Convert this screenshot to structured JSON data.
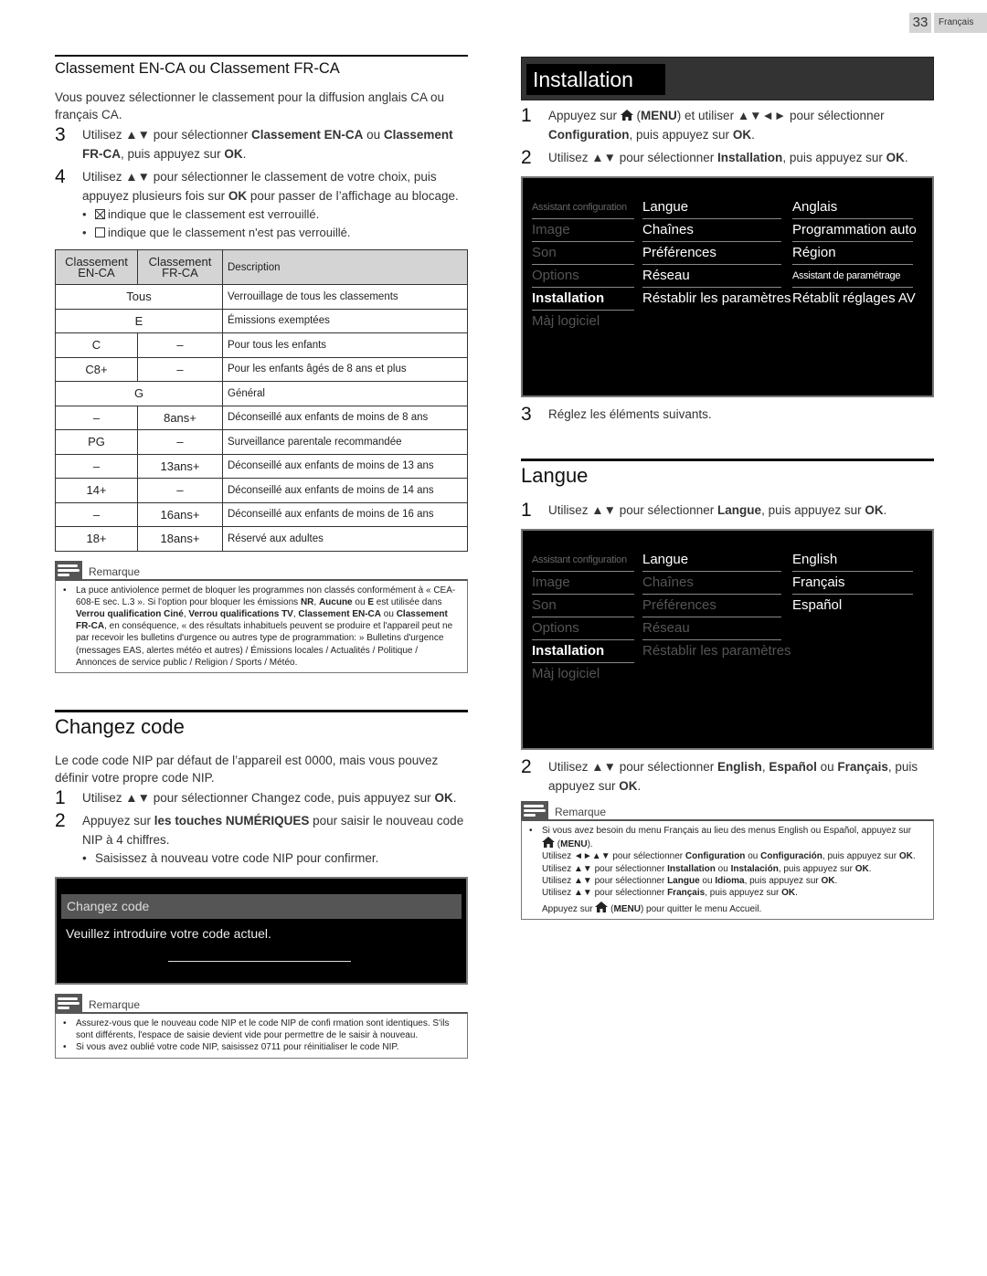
{
  "header": {
    "page_number": "33",
    "language": "Français"
  },
  "classement": {
    "title": "Classement EN-CA ou Classement FR-CA",
    "intro": "Vous pouvez sélectionner le classement pour la diffusion anglais CA ou français CA.",
    "step3": {
      "num": "3",
      "t1": "Utilisez ▲▼ pour sélectionner ",
      "b1": "Classement EN-CA",
      "t2": " ou ",
      "b2": "Classement FR-CA",
      "t3": ", puis appuyez sur ",
      "b3": "OK",
      "t4": "."
    },
    "step4": {
      "num": "4",
      "t1": "Utilisez ▲▼ pour sélectionner le classement de votre choix, puis appuyez plusieurs fois sur ",
      "b1": "OK",
      "t2": " pour passer de l’affichage au blocage."
    },
    "bullets": [
      {
        "icon": "checked-box",
        "text": "indique que le classement est verrouillé."
      },
      {
        "icon": "empty-box",
        "text": "indique que le classement n'est pas verrouillé."
      }
    ],
    "table": {
      "headers": [
        "Classement EN-CA",
        "Classement FR-CA",
        "Description"
      ],
      "rows": [
        {
          "en": "Tous",
          "fr": "",
          "merged": true,
          "desc": "Verrouillage de tous les classements"
        },
        {
          "en": "E",
          "fr": "",
          "merged": true,
          "desc": "Émissions exemptées"
        },
        {
          "en": "C",
          "fr": "–",
          "merged": false,
          "desc": "Pour tous les enfants"
        },
        {
          "en": "C8+",
          "fr": "–",
          "merged": false,
          "desc": "Pour les enfants âgés de 8 ans et plus"
        },
        {
          "en": "G",
          "fr": "",
          "merged": true,
          "desc": "Général"
        },
        {
          "en": "–",
          "fr": "8ans+",
          "merged": false,
          "desc": "Déconseillé aux enfants de moins de 8 ans"
        },
        {
          "en": "PG",
          "fr": "–",
          "merged": false,
          "desc": "Surveillance parentale recommandée"
        },
        {
          "en": "–",
          "fr": "13ans+",
          "merged": false,
          "desc": "Déconseillé aux enfants de moins de 13 ans"
        },
        {
          "en": "14+",
          "fr": "–",
          "merged": false,
          "desc": "Déconseillé aux enfants de moins de 14 ans"
        },
        {
          "en": "–",
          "fr": "16ans+",
          "merged": false,
          "desc": "Déconseillé aux enfants de moins de 16 ans"
        },
        {
          "en": "18+",
          "fr": "18ans+",
          "merged": false,
          "desc": "Réservé aux adultes"
        }
      ]
    },
    "note": {
      "title": "Remarque",
      "html_parts": {
        "a": "La puce antiviolence permet de bloquer les programmes non classés conformément à « CEA-608-E sec. L.3 ». Si l'option pour bloquer les émissions ",
        "b1": "NR",
        "c1": ", ",
        "b2": "Aucune",
        "c2": " ou ",
        "b3": "E",
        "c3": " est utilisée dans ",
        "b4": "Verrou qualification Ciné",
        "c4": ", ",
        "b5": "Verrou qualifications TV",
        "c5": ", ",
        "b6": "Classement EN-CA",
        "c6": " ou ",
        "b7": "Classement FR-CA",
        "c7": ", en conséquence, « des résultats inhabituels peuvent se produire et l'appareil peut ne par recevoir les bulletins d'urgence ou autres type de programmation: » Bulletins d'urgence (messages EAS, alertes météo et autres) / Émissions locales / Actualités / Politique / Annonces de service public / Religion / Sports / Météo."
      }
    }
  },
  "changez": {
    "title": "Changez code",
    "intro": "Le code code NIP par défaut de l’appareil est 0000, mais vous pouvez définir votre propre code NIP.",
    "step1": {
      "num": "1",
      "t1": "Utilisez ▲▼ pour sélectionner Changez code, puis appuyez sur ",
      "b1": "OK",
      "t2": "."
    },
    "step2": {
      "num": "2",
      "t1": "Appuyez sur ",
      "b1": "les touches NUMÉRIQUES",
      "t2": " pour saisir le nouveau code NIP à 4 chiffres."
    },
    "bullet": "Saisissez à nouveau votre code NIP pour confirmer.",
    "screen": {
      "title": "Changez code",
      "message": "Veuillez introduire votre code actuel.",
      "pin_value": ""
    },
    "note": {
      "title": "Remarque",
      "items": [
        "Assurez-vous que le nouveau code NIP et le code NIP de confi rmation sont identiques. S'ils sont différents, l'espace de saisie devient vide pour permettre de le saisir à nouveau.",
        "Si vous avez oublié votre code NIP, saisissez 0711 pour réinitialiser le code NIP."
      ]
    }
  },
  "installation": {
    "title": "Installation",
    "step1": {
      "num": "1",
      "t1": "Appuyez sur ",
      "t1b": " (",
      "b1": "MENU",
      "t2": ") et utiliser ▲▼◄► pour sélectionner ",
      "b2": "Configuration",
      "t3": ", puis appuyez sur ",
      "b3": "OK",
      "t4": "."
    },
    "step2": {
      "num": "2",
      "t1": "Utilisez ▲▼ pour sélectionner ",
      "b1": "Installation",
      "t2": ", puis appuyez sur ",
      "b2": "OK",
      "t3": "."
    },
    "menu": {
      "col1": [
        "Assistant configuration",
        "Image",
        "Son",
        "Options",
        "Installation",
        "Màj logiciel"
      ],
      "col2": [
        "Langue",
        "Chaînes",
        "Préférences",
        "Réseau",
        "Réstablir les paramètres"
      ],
      "col3": [
        "Anglais",
        "Programmation auto",
        "Région",
        "Assistant de paramétrage",
        "Rétablit réglages AV"
      ]
    },
    "step3": {
      "num": "3",
      "text": "Réglez les éléments suivants."
    }
  },
  "langue": {
    "title": "Langue",
    "step1": {
      "num": "1",
      "t1": "Utilisez ▲▼ pour sélectionner ",
      "b1": "Langue",
      "t2": ", puis appuyez sur ",
      "b2": "OK",
      "t3": "."
    },
    "menu": {
      "col1": [
        "Assistant configuration",
        "Image",
        "Son",
        "Options",
        "Installation",
        "Màj logiciel"
      ],
      "col2": [
        "Langue",
        "Chaînes",
        "Préférences",
        "Réseau",
        "Réstablir les paramètres"
      ],
      "col3": [
        "English",
        "Français",
        "Español"
      ]
    },
    "step2": {
      "num": "2",
      "t1": "Utilisez ▲▼ pour sélectionner ",
      "b1": "English",
      "t2": ", ",
      "b2": "Español",
      "t3": " ou ",
      "b3": "Français",
      "t4": ", puis appuyez sur ",
      "b4": "OK",
      "t5": "."
    },
    "note": {
      "title": "Remarque",
      "l1": "Si vous avez besoin du menu Français au lieu des menus English ou Español, appuyez sur",
      "l2a": " (",
      "l2b": "MENU",
      "l2c": ").",
      "l3a": "Utilisez ◄►▲▼ pour sélectionner ",
      "l3b": "Configuration",
      "l3c": " ou ",
      "l3d": "Configuración",
      "l3e": ", puis appuyez sur ",
      "l3f": "OK",
      "l3g": ".",
      "l4a": "Utilisez ▲▼ pour sélectionner ",
      "l4b": "Installation",
      "l4c": " ou ",
      "l4d": "Instalación",
      "l4e": ", puis appuyez sur ",
      "l4f": "OK",
      "l4g": ".",
      "l5a": "Utilisez ▲▼ pour sélectionner ",
      "l5b": "Langue",
      "l5c": " ou ",
      "l5d": "Idioma",
      "l5e": ", puis appuyez sur ",
      "l5f": "OK",
      "l5g": ".",
      "l6a": "Utilisez ▲▼ pour sélectionner ",
      "l6b": "Français",
      "l6c": ", puis appuyez sur ",
      "l6d": "OK",
      "l6e": ".",
      "l7a": "Appuyez sur ",
      "l7b": " (",
      "l7c": "MENU",
      "l7d": ") pour quitter le menu Accueil."
    }
  }
}
